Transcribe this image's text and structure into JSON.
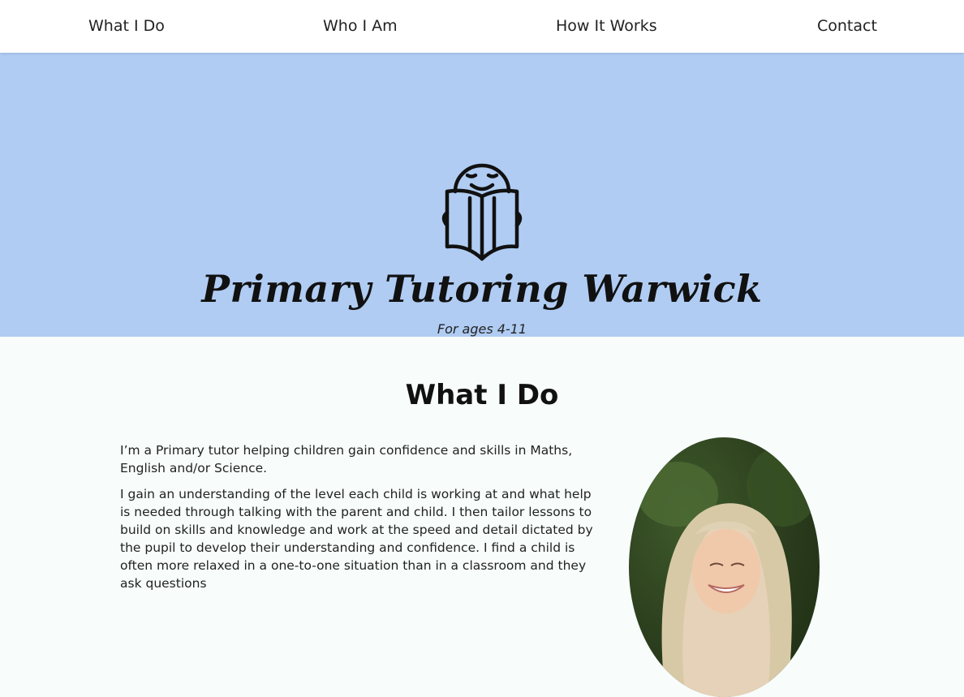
{
  "nav": {
    "items": [
      {
        "label": "What I Do"
      },
      {
        "label": "Who I Am"
      },
      {
        "label": "How It Works"
      },
      {
        "label": "Contact"
      }
    ]
  },
  "hero": {
    "logo_icon": "child-reading-book-icon",
    "title": "Primary Tutoring Warwick",
    "subtitle": "For ages 4-11",
    "background_color": "#b0ccf3"
  },
  "what_i_do": {
    "heading": "What I Do",
    "paragraphs": [
      "I’m a Primary tutor helping children gain confidence and skills in Maths, English and/or Science.",
      "I gain an understanding of the level each child is working at and what help is needed through talking with the parent and child. I then tailor lessons to build on skills and knowledge and work at the speed and detail dictated by the pupil to develop their understanding and confidence. I find a child is often more relaxed in a one-to-one situation than in a classroom and they ask questions"
    ],
    "portrait_icon": "tutor-portrait-photo"
  }
}
